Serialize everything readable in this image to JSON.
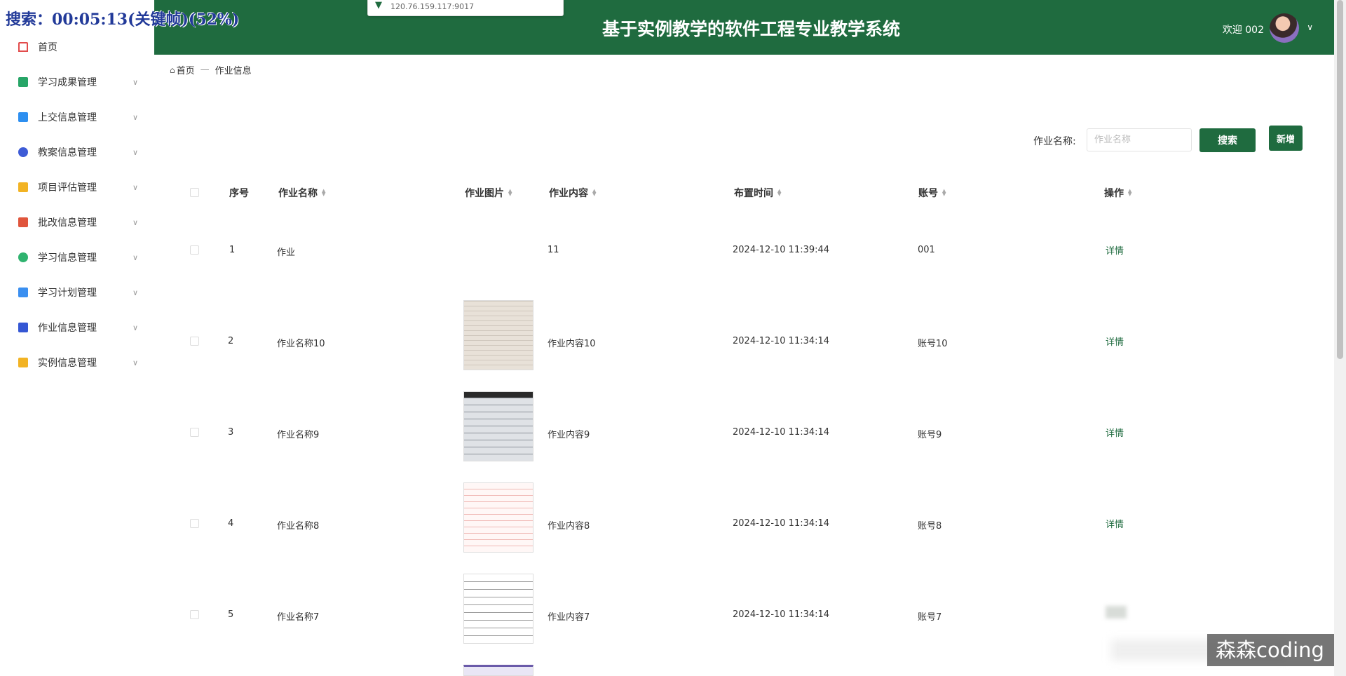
{
  "overlay": {
    "text": "搜索：00:05:13(关键帧)(52%)"
  },
  "browser": {
    "url": "120.76.159.117:9017"
  },
  "header": {
    "title": "基于实例教学的软件工程专业教学系统",
    "welcome": "欢迎 002"
  },
  "sidebar": {
    "items": [
      {
        "label": "首页",
        "icon": "home-icon",
        "color": "#e24c4c"
      },
      {
        "label": "学习成果管理",
        "icon": "crop-icon",
        "color": "#27a567"
      },
      {
        "label": "上交信息管理",
        "icon": "card-icon",
        "color": "#2d8ff0"
      },
      {
        "label": "教案信息管理",
        "icon": "mail-icon",
        "color": "#3d5bd6"
      },
      {
        "label": "项目评估管理",
        "icon": "grid-icon",
        "color": "#f2b324"
      },
      {
        "label": "批改信息管理",
        "icon": "doc-icon",
        "color": "#e0553c"
      },
      {
        "label": "学习信息管理",
        "icon": "leaf-icon",
        "color": "#2fb36f"
      },
      {
        "label": "学习计划管理",
        "icon": "copy-icon",
        "color": "#3a8ff0"
      },
      {
        "label": "作业信息管理",
        "icon": "book-icon",
        "color": "#3557d4"
      },
      {
        "label": "实例信息管理",
        "icon": "bag-icon",
        "color": "#f2b324"
      }
    ]
  },
  "breadcrumb": {
    "home": "首页",
    "sep": "—",
    "current": "作业信息"
  },
  "search": {
    "label": "作业名称:",
    "placeholder": "作业名称",
    "search_button": "搜索",
    "add_button": "新增"
  },
  "table": {
    "headers": [
      "序号",
      "作业名称",
      "作业图片",
      "作业内容",
      "布置时间",
      "账号",
      "操作"
    ],
    "rows": [
      {
        "no": "1",
        "name": "作业",
        "content": "11",
        "time": "2024-12-10 11:39:44",
        "account": "001",
        "action": "详情"
      },
      {
        "no": "2",
        "name": "作业名称10",
        "content": "作业内容10",
        "time": "2024-12-10 11:34:14",
        "account": "账号10",
        "action": "详情"
      },
      {
        "no": "3",
        "name": "作业名称9",
        "content": "作业内容9",
        "time": "2024-12-10 11:34:14",
        "account": "账号9",
        "action": "详情"
      },
      {
        "no": "4",
        "name": "作业名称8",
        "content": "作业内容8",
        "time": "2024-12-10 11:34:14",
        "account": "账号8",
        "action": "详情"
      },
      {
        "no": "5",
        "name": "作业名称7",
        "content": "作业内容7",
        "time": "2024-12-10 11:34:14",
        "account": "账号7",
        "action": ""
      }
    ]
  },
  "watermark": "森森coding"
}
